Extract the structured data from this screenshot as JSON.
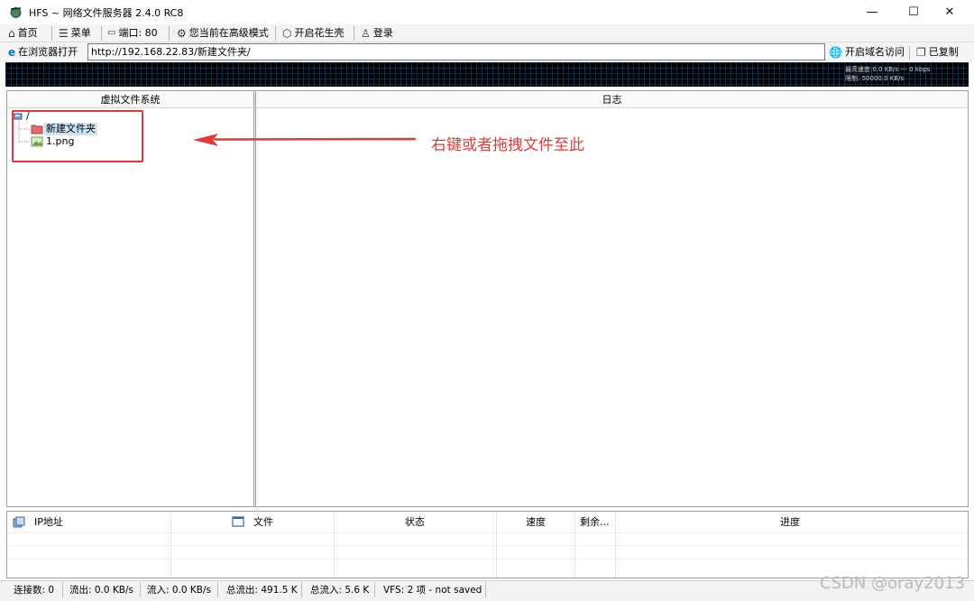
{
  "window": {
    "title": "HFS ~ 网络文件服务器 2.4.0 RC8",
    "minimize": "—",
    "maximize": "☐",
    "close": "✕"
  },
  "toolbar": {
    "home": "首页",
    "menu": "菜单",
    "port": "端口: 80",
    "mode": "您当前在高级模式",
    "peanut": "开启花生壳",
    "login": "登录"
  },
  "address": {
    "open_browser": "在浏览器打开",
    "url": "http://192.168.22.83/新建文件夹/",
    "domain_access": "开启域名访问",
    "copied": "已复制"
  },
  "graph": {
    "speed_label": "最高速度:0.0 KB/s  ---  0 kbps",
    "limit_label": "限制: 50000.0 KB/s"
  },
  "vfs": {
    "header": "虚拟文件系统",
    "root": "/",
    "items": [
      {
        "label": "新建文件夹",
        "type": "folder",
        "selected": true
      },
      {
        "label": "1.png",
        "type": "file",
        "selected": false
      }
    ]
  },
  "log": {
    "header": "日志"
  },
  "annotation": {
    "text": "右键或者拖拽文件至此"
  },
  "connections": {
    "columns": [
      "IP地址",
      "文件",
      "状态",
      "速度",
      "剩余...",
      "进度"
    ]
  },
  "status": {
    "connections": "连接数: 0",
    "out": "流出: 0.0 KB/s",
    "in": "流入: 0.0 KB/s",
    "total_out": "总流出: 491.5 K",
    "total_in": "总流入: 5.6 K",
    "vfs": "VFS: 2 项 - not saved"
  },
  "watermark": "CSDN @oray2013",
  "colors": {
    "annotation": "#e03b3b",
    "selection": "#cce4f7"
  }
}
